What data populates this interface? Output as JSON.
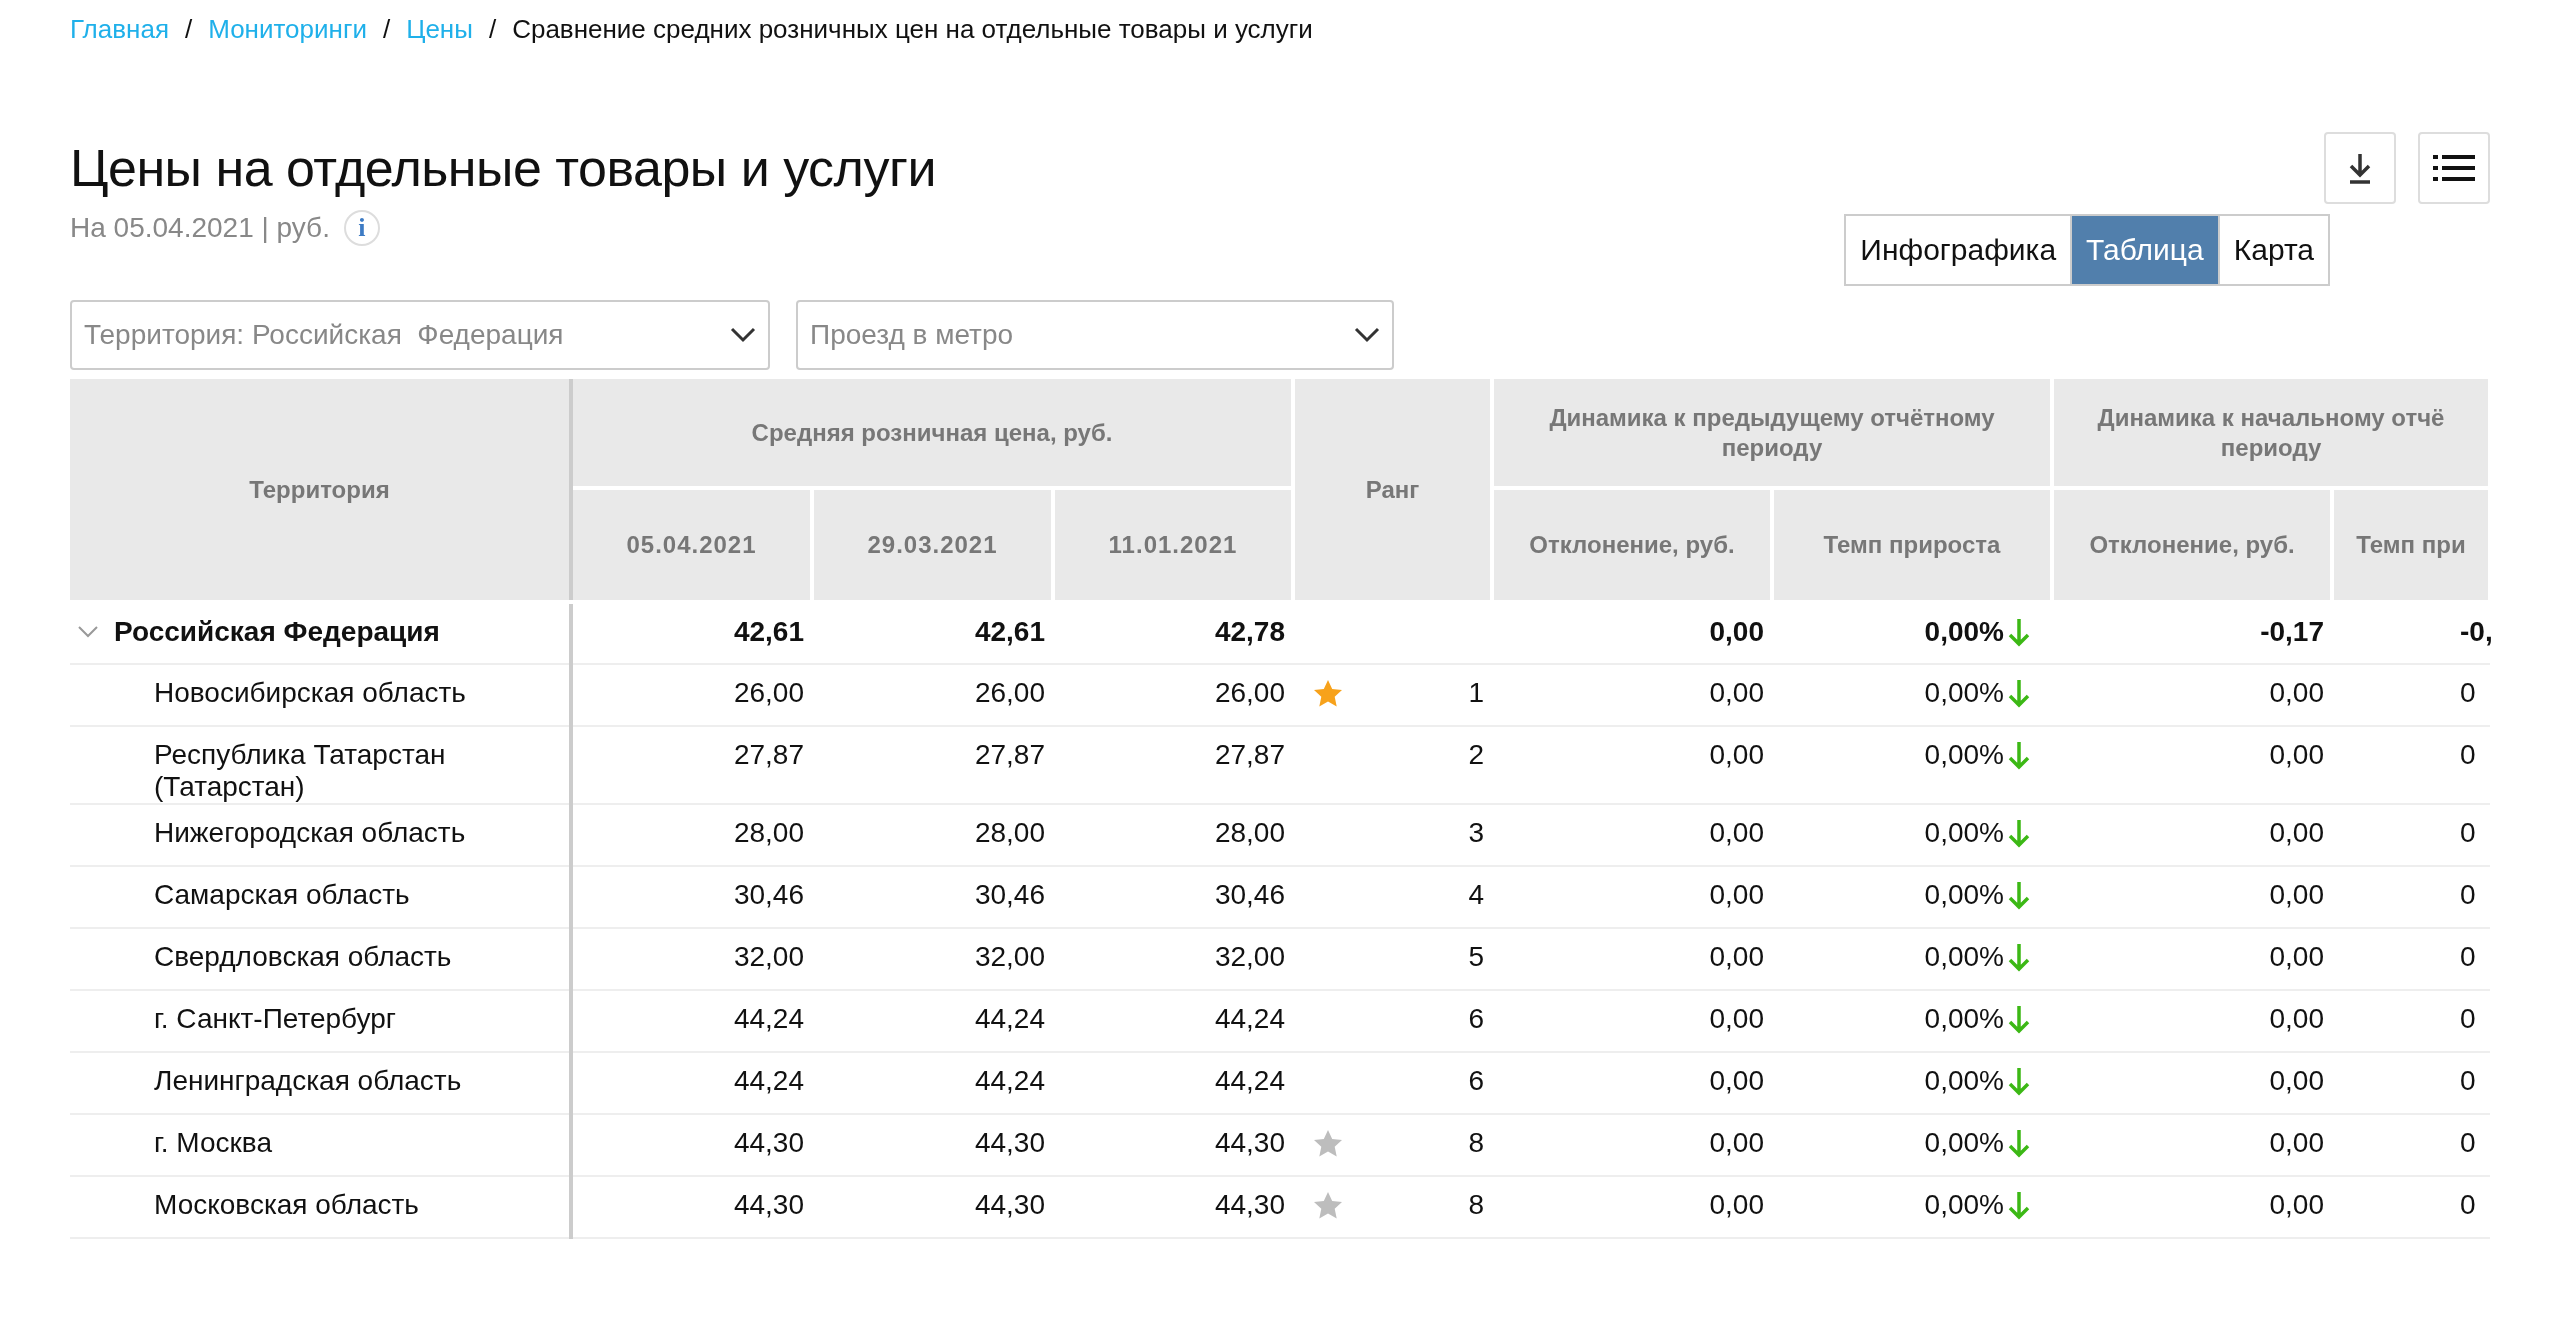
{
  "breadcrumbs": [
    {
      "label": "Главная",
      "link": true
    },
    {
      "label": "Мониторинги",
      "link": true
    },
    {
      "label": "Цены",
      "link": true
    },
    {
      "label": "Сравнение средних розничных цен на отдельные товары и услуги",
      "link": false
    }
  ],
  "breadcrumb_separator": "/",
  "title": "Цены на отдельные товары и услуги",
  "subtitle": "На 05.04.2021 | руб.",
  "info_mark": "i",
  "tabs": [
    {
      "label": "Инфографика",
      "selected": false
    },
    {
      "label": "Таблица",
      "selected": true
    },
    {
      "label": "Карта",
      "selected": false
    }
  ],
  "filters": [
    {
      "value": "Территория: Российская  Федерация"
    },
    {
      "value": "Проезд в метро"
    }
  ],
  "table": {
    "header": {
      "territory": "Территория",
      "price_group": "Средняя розничная цена, руб.",
      "dates": [
        "05.04.2021",
        "29.03.2021",
        "11.01.2021"
      ],
      "rank": "Ранг",
      "groups": [
        {
          "lines": [
            "Динамика к предыдущему отчётному",
            "периоду"
          ],
          "columns": [
            "Отклонение, руб.",
            "Темп прироста"
          ]
        },
        {
          "lines": [
            "Динамика к начальному отчё",
            "периоду"
          ],
          "columns": [
            "Отклонение, руб.",
            "Темп при"
          ]
        }
      ]
    },
    "rows": [
      {
        "name": "Российская Федерация",
        "expanded": true,
        "prices": [
          "42,61",
          "42,61",
          "42,78"
        ],
        "dev_prev": "0,00",
        "rate_prev": "0,00%",
        "falling": true,
        "dev_start": "-0,17",
        "rate_start": "-0,",
        "children": [
          {
            "name": "Новосибирская область",
            "color": "#f7a21b",
            "rank": "1",
            "prices": [
              "26,00",
              "26,00",
              "26,00"
            ],
            "dev_prev": "0,00",
            "rate_prev": "0,00%",
            "falling": true,
            "dev_start": "0,00",
            "rate_start": "0"
          },
          {
            "name": "Республика Татарстан (Татарстан)",
            "rank": "2",
            "prices": [
              "27,87",
              "27,87",
              "27,87"
            ],
            "dev_prev": "0,00",
            "rate_prev": "0,00%",
            "falling": true,
            "dev_start": "0,00",
            "rate_start": "0"
          },
          {
            "name": "Нижегородская область",
            "rank": "3",
            "prices": [
              "28,00",
              "28,00",
              "28,00"
            ],
            "dev_prev": "0,00",
            "rate_prev": "0,00%",
            "falling": true,
            "dev_start": "0,00",
            "rate_start": "0"
          },
          {
            "name": "Самарская область",
            "rank": "4",
            "prices": [
              "30,46",
              "30,46",
              "30,46"
            ],
            "dev_prev": "0,00",
            "rate_prev": "0,00%",
            "falling": true,
            "dev_start": "0,00",
            "rate_start": "0"
          },
          {
            "name": "Свердловская область",
            "rank": "5",
            "prices": [
              "32,00",
              "32,00",
              "32,00"
            ],
            "dev_prev": "0,00",
            "rate_prev": "0,00%",
            "falling": true,
            "dev_start": "0,00",
            "rate_start": "0"
          },
          {
            "name": "г. Санкт-Петербург",
            "rank": "6",
            "prices": [
              "44,24",
              "44,24",
              "44,24"
            ],
            "dev_prev": "0,00",
            "rate_prev": "0,00%",
            "falling": true,
            "dev_start": "0,00",
            "rate_start": "0"
          },
          {
            "name": "Ленинградская область",
            "rank": "6",
            "prices": [
              "44,24",
              "44,24",
              "44,24"
            ],
            "dev_prev": "0,00",
            "rate_prev": "0,00%",
            "falling": true,
            "dev_start": "0,00",
            "rate_start": "0"
          },
          {
            "name": "г. Москва",
            "color": "#bdbdbd",
            "rank": "8",
            "prices": [
              "44,30",
              "44,30",
              "44,30"
            ],
            "dev_prev": "0,00",
            "rate_prev": "0,00%",
            "falling": true,
            "dev_start": "0,00",
            "rate_start": "0"
          },
          {
            "name": "Московская область",
            "color": "#bdbdbd",
            "rank": "8",
            "prices": [
              "44,30",
              "44,30",
              "44,30"
            ],
            "dev_prev": "0,00",
            "rate_prev": "0,00%",
            "falling": true,
            "dev_start": "0,00",
            "rate_start": "0"
          }
        ]
      }
    ]
  }
}
